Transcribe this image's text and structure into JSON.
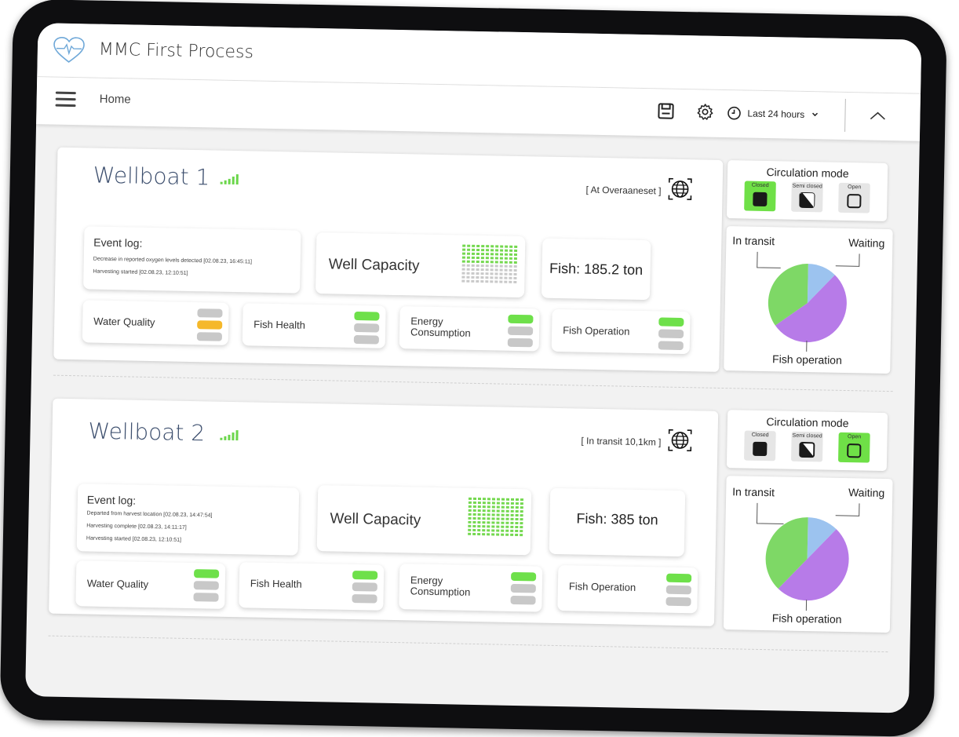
{
  "app": {
    "title": "MMC First Process"
  },
  "toolbar": {
    "breadcrumb": "Home",
    "time_range": "Last 24 hours"
  },
  "boats": [
    {
      "name": "Wellboat 1",
      "location": "[ At Overaaneset ]",
      "event_log": {
        "title": "Event log:",
        "entries": [
          "Decrease in reported oxygen levels detected  [02.08.23, 16:45:11]",
          "Harvesting started  [02.08.23, 12:10:51]"
        ]
      },
      "well_capacity": {
        "label": "Well Capacity",
        "fill": 0.5
      },
      "fish": "Fish: 185.2 ton",
      "status": [
        {
          "label": "Water Quality",
          "level": "amber"
        },
        {
          "label": "Fish Health",
          "level": "green"
        },
        {
          "label": "Energy Consumption",
          "level": "green"
        },
        {
          "label": "Fish Operation",
          "level": "green"
        }
      ],
      "circulation": {
        "title": "Circulation mode",
        "modes": [
          "Closed",
          "Semi closed",
          "Open"
        ],
        "active": "Closed"
      },
      "chart_data": {
        "type": "pie",
        "labels": [
          "In transit",
          "Waiting",
          "Fish operation"
        ],
        "values": [
          35,
          12,
          53
        ],
        "colors": [
          "#7ed866",
          "#9cc3ef",
          "#b77be8"
        ]
      }
    },
    {
      "name": "Wellboat 2",
      "location": "[ In transit 10,1km ]",
      "event_log": {
        "title": "Event log:",
        "entries": [
          "Departed from harvest location [02.08.23, 14:47:54]",
          "Harvesting complete  [02.08.23, 14:11:17]",
          "Harvesting started  [02.08.23, 12:10:51]"
        ]
      },
      "well_capacity": {
        "label": "Well Capacity",
        "fill": 1.0
      },
      "fish": "Fish: 385 ton",
      "status": [
        {
          "label": "Water Quality",
          "level": "green"
        },
        {
          "label": "Fish Health",
          "level": "green"
        },
        {
          "label": "Energy Consumption",
          "level": "green"
        },
        {
          "label": "Fish Operation",
          "level": "green"
        }
      ],
      "circulation": {
        "title": "Circulation mode",
        "modes": [
          "Closed",
          "Semi closed",
          "Open"
        ],
        "active": "Open"
      },
      "chart_data": {
        "type": "pie",
        "labels": [
          "In transit",
          "Waiting",
          "Fish operation"
        ],
        "values": [
          38,
          12,
          50
        ],
        "colors": [
          "#7ed866",
          "#9cc3ef",
          "#b77be8"
        ]
      }
    }
  ]
}
